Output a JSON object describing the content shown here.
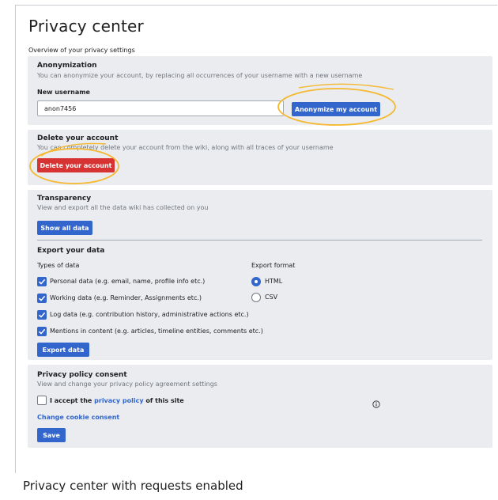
{
  "page_title": "Privacy center",
  "overview": "Overview of your privacy settings",
  "anonymization": {
    "heading": "Anonymization",
    "description": "You can anonymize your account, by replacing all occurrences of your username with a new username",
    "field_label": "New username",
    "field_value": "anon7456",
    "button": "Anonymize my account"
  },
  "delete": {
    "heading": "Delete your account",
    "description": "You can completely delete your account from the wiki, along with all traces of your username",
    "button": "Delete your account"
  },
  "transparency": {
    "heading": "Transparency",
    "description": "View and export all the data wiki has collected on you",
    "button": "Show all data"
  },
  "export": {
    "heading": "Export your data",
    "types_label": "Types of data",
    "format_label": "Export format",
    "types": [
      {
        "label": "Personal data (e.g. email, name, profile info etc.)",
        "checked": true
      },
      {
        "label": "Working data (e.g. Reminder, Assignments etc.)",
        "checked": true
      },
      {
        "label": "Log data (e.g. contribution history, administrative actions etc.)",
        "checked": true
      },
      {
        "label": "Mentions in content (e.g. articles, timeline entities, comments etc.)",
        "checked": true
      }
    ],
    "formats": [
      {
        "label": "HTML",
        "selected": true
      },
      {
        "label": "CSV",
        "selected": false
      }
    ],
    "button": "Export data"
  },
  "consent": {
    "heading": "Privacy policy consent",
    "description": "View and change your privacy policy agreement settings",
    "accept_prefix": "I accept the ",
    "accept_link": "privacy policy",
    "accept_suffix": " of this site",
    "cookie_link": "Change cookie consent",
    "button": "Save"
  },
  "caption": "Privacy center with requests enabled",
  "icons": [
    "checkmark-icon",
    "info-icon"
  ],
  "colors": {
    "primary": "#3366cc",
    "destructive": "#d73333",
    "panel": "#eaecf0",
    "highlight": "#f5b82e"
  }
}
